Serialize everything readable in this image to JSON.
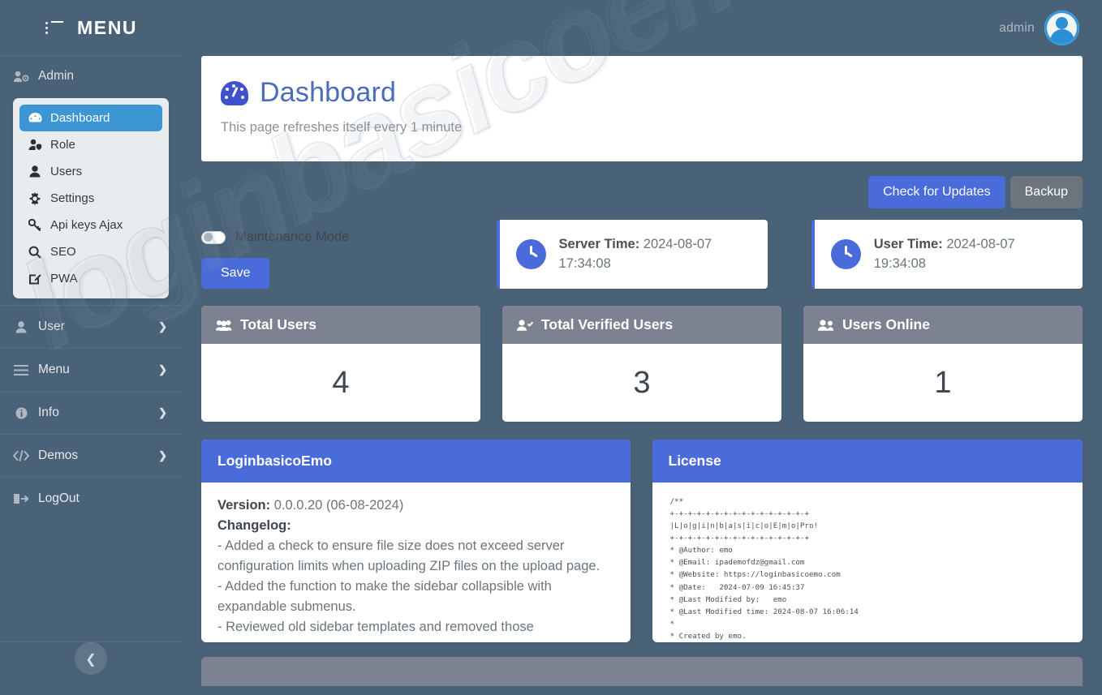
{
  "topbar": {
    "menu_label": "MENU",
    "menu_icon": "list-icon",
    "admin_name": "admin",
    "avatar_icon": "user-avatar-icon"
  },
  "sidebar": {
    "admin_label": "Admin",
    "admin_icon": "users-cog-icon",
    "submenu": [
      {
        "label": "Dashboard",
        "icon": "tachometer-icon",
        "active": true
      },
      {
        "label": "Role",
        "icon": "user-shield-icon",
        "active": false
      },
      {
        "label": "Users",
        "icon": "user-icon",
        "active": false
      },
      {
        "label": "Settings",
        "icon": "gear-icon",
        "active": false
      },
      {
        "label": "Api keys Ajax",
        "icon": "key-icon",
        "active": false
      },
      {
        "label": "SEO",
        "icon": "search-icon",
        "active": false
      },
      {
        "label": "PWA",
        "icon": "edit-square-icon",
        "active": false
      }
    ],
    "groups": [
      {
        "label": "User",
        "icon": "user-icon",
        "chevron": "chevron-right-icon"
      },
      {
        "label": "Menu",
        "icon": "bars-icon",
        "chevron": "chevron-right-icon"
      },
      {
        "label": "Info",
        "icon": "info-circle-icon",
        "chevron": "chevron-right-icon"
      },
      {
        "label": "Demos",
        "icon": "code-icon",
        "chevron": "chevron-right-icon"
      },
      {
        "label": "LogOut",
        "icon": "sign-out-icon",
        "chevron": ""
      }
    ],
    "collapse_icon": "chevron-left-icon"
  },
  "page": {
    "title": "Dashboard",
    "title_icon": "tachometer-icon",
    "subtitle": "This page refreshes itself every 1 minute"
  },
  "actions": {
    "check_updates_label": "Check for Updates",
    "backup_label": "Backup"
  },
  "maintenance": {
    "label": "Maintenance Mode",
    "toggle_state": "off",
    "save_label": "Save"
  },
  "times": {
    "server_label": "Server Time:",
    "server_value": "2024-08-07 17:34:08",
    "user_label": "User Time:",
    "user_value": "2024-08-07 19:34:08",
    "clock_icon": "clock-icon"
  },
  "stats": [
    {
      "title": "Total Users",
      "icon": "users-icon",
      "value": "4"
    },
    {
      "title": "Total Verified Users",
      "icon": "user-check-icon",
      "value": "3"
    },
    {
      "title": "Users Online",
      "icon": "user-friends-icon",
      "value": "1"
    }
  ],
  "changelog": {
    "panel_title": "LoginbasicoEmo",
    "version_label": "Version:",
    "version_value": "0.0.0.20 (06-08-2024)",
    "changelog_label": "Changelog:",
    "entries": [
      "- Added a check to ensure file size does not exceed server configuration limits when uploading ZIP files on the upload page.",
      "- Added the function to make the sidebar collapsible with expandable submenus.",
      "- Reviewed old sidebar templates and removed those"
    ]
  },
  "license": {
    "panel_title": "License",
    "code": "/**\n+-+-+-+-+-+-+-+-+-+-+-+-+-+-+-+\n|L|o|g|i|n|b|a|s|i|c|o|E|m|o|Pro!\n+-+-+-+-+-+-+-+-+-+-+-+-+-+-+-+\n* @Author: emo\n* @Email: ipademofdz@gmail.com\n* @Website: https://loginbasicoemo.com\n* @Date:   2024-07-09 16:45:37\n* @Last Modified by:   emo\n* @Last Modified time: 2024-08-07 16:06:14\n*\n* Created by emo.\n*"
  },
  "watermark": {
    "text": "loginbasicoemo.com"
  },
  "colors": {
    "sidebar": "#4a6278",
    "accent_blue": "#4a6cda",
    "active_blue": "#3d96d4",
    "stat_header_gray": "#7c828f",
    "title_blue": "#4a6cc0"
  }
}
